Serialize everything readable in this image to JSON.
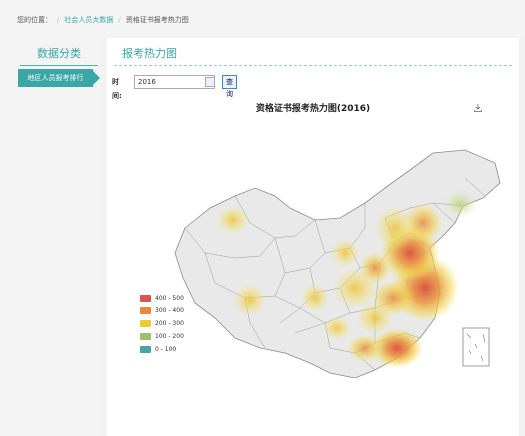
{
  "breadcrumb": {
    "prefix": "您的位置：",
    "items": [
      "社会人员大数据",
      "资格证书报考热力图"
    ]
  },
  "sidebar": {
    "title": "数据分类",
    "items": [
      {
        "label": "地区人员报考排行"
      }
    ]
  },
  "main": {
    "title": "报考热力图",
    "filter": {
      "time_label": "时间:",
      "year_value": "2016",
      "query_label": "查询"
    }
  },
  "chart": {
    "title": "资格证书报考热力图(2016)",
    "download_icon": "download-icon"
  },
  "chart_data": {
    "type": "heatmap",
    "title": "资格证书报考热力图(2016)",
    "legend": {
      "placement": "bottom-left",
      "ranges": [
        {
          "label": "400 - 500",
          "color": "#d9534f"
        },
        {
          "label": "300 - 400",
          "color": "#e8893e"
        },
        {
          "label": "200 - 300",
          "color": "#eccc2e"
        },
        {
          "label": "100 - 200",
          "color": "#9bbf6e"
        },
        {
          "label": "0 - 100",
          "color": "#4aa3a6"
        }
      ]
    }
  }
}
